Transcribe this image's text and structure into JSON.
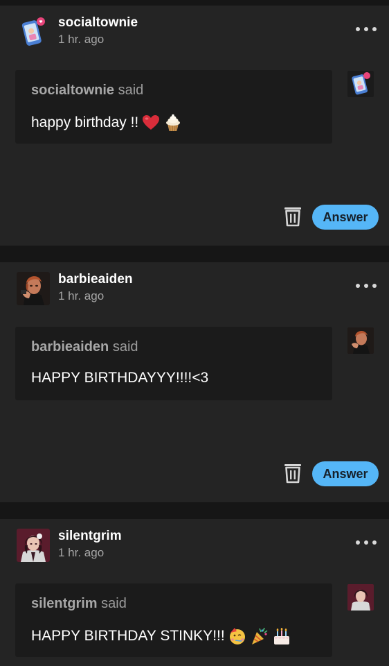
{
  "colors": {
    "background": "#161616",
    "card": "#242424",
    "bubble": "#1b1b1b",
    "accent": "#55b6f7"
  },
  "posts": [
    {
      "username": "socialtownie",
      "time": "1 hr. ago",
      "said_name": "socialtownie",
      "said_word": "said",
      "message": "happy birthday !!",
      "emojis": [
        "red-heart",
        "cupcake"
      ],
      "answer_label": "Answer",
      "avatar_icon": "phone-avatar"
    },
    {
      "username": "barbieaiden",
      "time": "1 hr. ago",
      "said_name": "barbieaiden",
      "said_word": "said",
      "message": "HAPPY BIRTHDAYYY!!!!<3",
      "emojis": [],
      "answer_label": "Answer",
      "avatar_icon": "portrait-avatar"
    },
    {
      "username": "silentgrim",
      "time": "1 hr. ago",
      "said_name": "silentgrim",
      "said_word": "said",
      "message": "HAPPY BIRTHDAY STINKY!!!",
      "emojis": [
        "partying-face",
        "party-popper",
        "birthday-cake"
      ],
      "avatar_icon": "portrait-avatar"
    }
  ]
}
